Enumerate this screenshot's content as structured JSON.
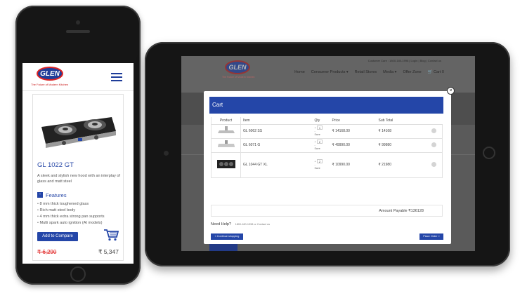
{
  "phone": {
    "logo_text": "GLEN",
    "tagline": "The Future of Modern Kitchen",
    "product_title": "GL 1022 GT",
    "description": "A sleek and stylish new hood with an interplay of glass and matt steel",
    "features_toggle": "-",
    "features_label": "Features",
    "features": [
      "8 mm thick toughened glass",
      "Rich matt steel body",
      "4 mm thick extra strong pan supports",
      "Multi spark auto ignition (AI models)"
    ],
    "compare_label": "Add to Compare",
    "old_price": "₹ 6,290",
    "new_price": "₹ 5,347"
  },
  "tablet": {
    "logo_text": "GLEN",
    "tagline": "The Future of Modern Kitchen",
    "topbar": "Customer Care : 1800-180-1998 | Login | Blog | Contact us",
    "nav": [
      "Home",
      "Consumer Products ▾",
      "Retail Stores",
      "Media ▾",
      "Offer Zone",
      "🛒 Cart 0"
    ],
    "modal": {
      "close": "×",
      "title": "Cart",
      "columns": [
        "Product",
        "Item",
        "Qty",
        "Price",
        "Sub Total"
      ],
      "rows": [
        {
          "item": "GL 6062 SS",
          "qty": "1",
          "qty_up": "+",
          "qty_down": "-",
          "save": "Save",
          "price": "₹ 14168.00",
          "subtotal": "₹ 14168"
        },
        {
          "item": "GL 6071 G",
          "qty": "2",
          "qty_up": "+",
          "qty_down": "-",
          "save": "Save",
          "price": "₹ 49990.00",
          "subtotal": "₹ 99980"
        },
        {
          "item": "GL 1044 GT XL",
          "qty": "2",
          "qty_up": "+",
          "qty_down": "-",
          "save": "Save",
          "price": "₹ 10990.00",
          "subtotal": "₹ 21980"
        }
      ],
      "amount_payable": "Amount Payable  ₹136128",
      "need_help": "Need Help?",
      "help_contact": "1800-180-1998 or Contact us",
      "continue_label": "« Continue shopping",
      "place_order_label": "Place Order »"
    }
  },
  "colors": {
    "brand_blue": "#2446a8",
    "old_price_red": "#e02020"
  }
}
